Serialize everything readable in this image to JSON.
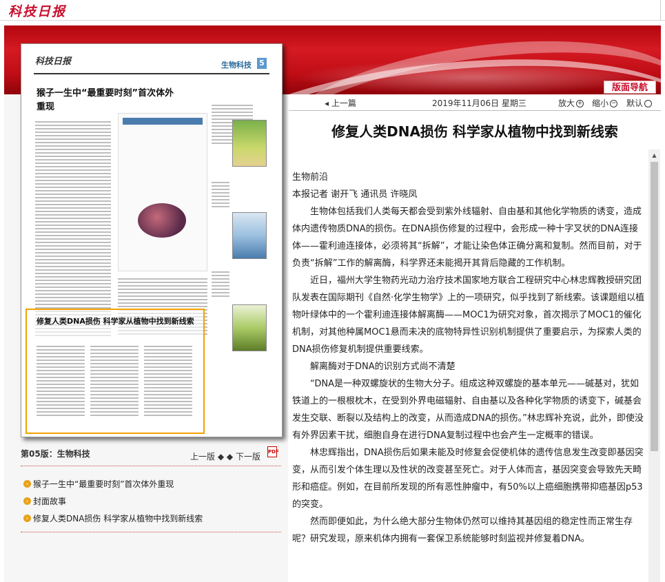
{
  "header": {
    "logo_text": "科技日报"
  },
  "banner": {
    "nav_button": "版面导航"
  },
  "thumbnail": {
    "masthead": "科技日报",
    "section_label": "生物科技",
    "page_number": "5",
    "headline_top": "猴子一生中“最重要时刻”首次体外重现",
    "headline_highlight": "修复人类DNA损伤 科学家从植物中找到新线索"
  },
  "edition": {
    "label": "第05版：生物科技",
    "prev_page": "上一版",
    "next_page": "下一版",
    "pdf_icon": "pdf-icon"
  },
  "toc": [
    {
      "label": "猴子一生中“最重要时刻”首次体外重现"
    },
    {
      "label": "封面故事"
    },
    {
      "label": "修复人类DNA损伤 科学家从植物中找到新线索"
    }
  ],
  "toolbar": {
    "prev_article": "上一篇",
    "date": "2019年11月06日 星期三",
    "zoom_in": "放大",
    "zoom_out": "缩小",
    "zoom_reset": "默认"
  },
  "article": {
    "title": "修复人类DNA损伤 科学家从植物中找到新线索",
    "category": "生物前沿",
    "byline": "本报记者 谢开飞 通讯员 许晓凤",
    "paragraphs": [
      "生物体包括我们人类每天都会受到紫外线辐射、自由基和其他化学物质的诱变，造成体内遗传物质DNA的损伤。在DNA损伤修复的过程中，会形成一种十字叉状的DNA连接体——霍利迪连接体，必须将其“拆解”，才能让染色体正确分离和复制。然而目前，对于负责“拆解”工作的解离酶，科学界还未能揭开其背后隐藏的工作机制。",
      "近日，福州大学生物药光动力治疗技术国家地方联合工程研究中心林忠辉教授研究团队发表在国际期刊《自然·化学生物学》上的一项研究，似乎找到了新线索。该课题组以植物叶绿体中的一个霍利迪连接体解离酶——MOC1为研究对象，首次揭示了MOC1的催化机制，对其他种属MOC1悬而未决的底物特异性识别机制提供了重要启示，为探索人类的DNA损伤修复机制提供重要线索。"
    ],
    "subheading": "解离酶对于DNA的识别方式尚不清楚",
    "paragraphs2": [
      "“DNA是一种双螺旋状的生物大分子。组成这种双螺旋的基本单元——碱基对，犹如铁道上的一根根枕木，在受到外界电磁辐射、自由基以及各种化学物质的诱变下，碱基会发生交联、断裂以及结构上的改变，从而造成DNA的损伤。”林忠辉补充说，此外，即使没有外界因素干扰，细胞自身在进行DNA复制过程中也会产生一定概率的错误。",
      "林忠辉指出，DNA损伤后如果未能及时修复会促使机体的遗传信息发生改变即基因突变，从而引发个体生理以及性状的改变甚至死亡。对于人体而言，基因突变会导致先天畸形和癌症。例如，在目前所发现的所有恶性肿瘤中，有50%以上癌细胞携带抑癌基因p53的突变。",
      "然而即便如此，为什么绝大部分生物体仍然可以维持其基因组的稳定性而正常生存呢？研究发现，原来机体内拥有一套保卫系统能够时刻监视并修复着DNA。"
    ]
  }
}
